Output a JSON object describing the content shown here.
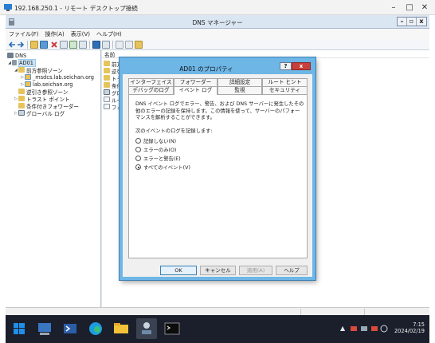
{
  "rdp": {
    "title": "192.168.250.1 - リモート デスクトップ接続",
    "minimize": "–",
    "maximize": "□",
    "close": "✕"
  },
  "dns": {
    "title": "DNS マネージャー",
    "controls": {
      "minimize": "–",
      "maximize": "▫",
      "close": "x"
    },
    "menu": [
      "ファイル(F)",
      "操作(A)",
      "表示(V)",
      "ヘルプ(H)"
    ],
    "tree": [
      {
        "label": "DNS",
        "icon": "dns-server-icon"
      },
      {
        "label": "AD01",
        "icon": "server-icon"
      },
      {
        "label": "前方参照ゾーン",
        "icon": "folder-icon"
      },
      {
        "label": "_msdcs.lab.seichan.org",
        "icon": "zone-icon"
      },
      {
        "label": "lab.seichan.org",
        "icon": "zone-icon"
      },
      {
        "label": "逆引き参照ゾーン",
        "icon": "folder-icon"
      },
      {
        "label": "トラスト ポイント",
        "icon": "folder-icon"
      },
      {
        "label": "条件付きフォワーダー",
        "icon": "folder-icon"
      },
      {
        "label": "グローバル ログ",
        "icon": "log-icon"
      }
    ],
    "list": {
      "header": "名前",
      "rows": [
        {
          "label": "前方",
          "icon": "folder-icon"
        },
        {
          "label": "逆引",
          "icon": "folder-icon"
        },
        {
          "label": "トラ",
          "icon": "folder-icon"
        },
        {
          "label": "条件",
          "icon": "folder-icon"
        },
        {
          "label": "グロ",
          "icon": "log-icon"
        },
        {
          "label": "ルー",
          "icon": "doc-icon"
        },
        {
          "label": "フォ",
          "icon": "doc-icon"
        }
      ]
    }
  },
  "dialog": {
    "title": "AD01 のプロパティ",
    "help": "?",
    "close": "x",
    "tabs_row1": [
      "インターフェイス",
      "フォワーダー",
      "詳細設定",
      "ルート ヒント"
    ],
    "tabs_row2": [
      "デバッグのログ",
      "イベント ログ",
      "監視",
      "セキュリティ"
    ],
    "description": "DNS イベント ログでエラー、警告、および DNS サーバーに発生したその他のエラーの記録を保持します。この情報を使って、サーバーのパフォーマンスを解析することができます。",
    "prompt": "次のイベントのログを記録します:",
    "options": [
      {
        "label": "記録しない(N)",
        "checked": false
      },
      {
        "label": "エラーのみ(O)",
        "checked": false
      },
      {
        "label": "エラーと警告(E)",
        "checked": false
      },
      {
        "label": "すべてのイベント(V)",
        "checked": true
      }
    ],
    "buttons": {
      "ok": "OK",
      "cancel": "キャンセル",
      "apply": "適用(A)",
      "help": "ヘルプ"
    }
  },
  "taskbar": {
    "apps": [
      "windows-start-icon",
      "server-manager-icon",
      "powershell-icon",
      "edge-icon",
      "file-explorer-icon",
      "dns-manager-icon",
      "command-prompt-icon"
    ],
    "tray_chevron": "▲",
    "time": "7:15",
    "date": "2024/02/19"
  }
}
